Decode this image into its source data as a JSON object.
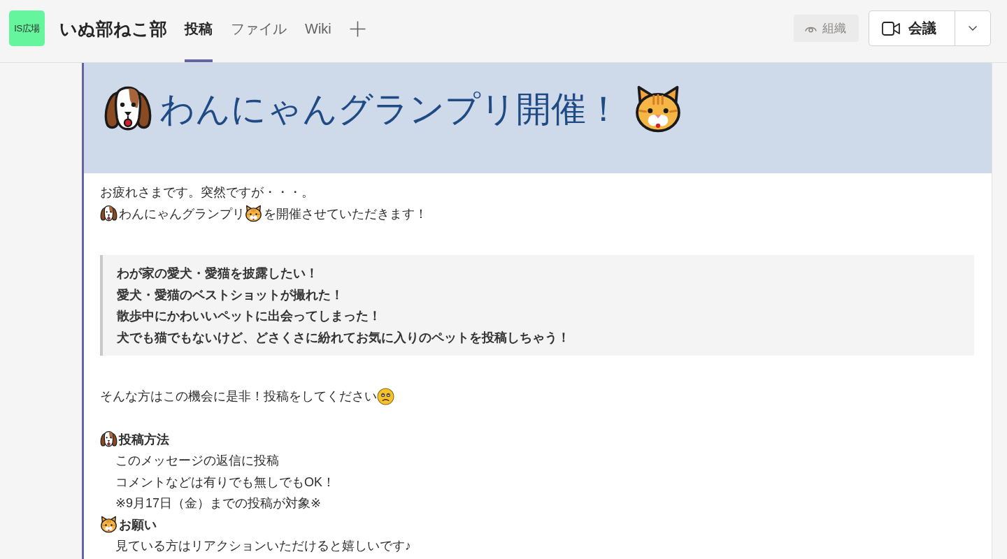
{
  "channel_header": {
    "team_avatar": {
      "label": "IS広場"
    },
    "team_name": "いぬ部ねこ部",
    "tabs": [
      {
        "label": "投稿",
        "selected": true
      },
      {
        "label": "ファイル",
        "selected": false
      },
      {
        "label": "Wiki",
        "selected": false
      }
    ],
    "org_button": {
      "label": "組織"
    },
    "meeting_button": {
      "label": "会議"
    }
  },
  "post": {
    "banner": [
      {
        "kind": "dog"
      },
      {
        "kind": "text",
        "text": "わんにゃんグランプリ開催！"
      },
      {
        "kind": "cat"
      }
    ],
    "blocks": [
      {
        "kind": "paragraph",
        "lines": [
          {
            "segments": [
              {
                "kind": "text",
                "text": "お疲れさまです。突然ですが・・・。"
              }
            ]
          },
          {
            "segments": [
              {
                "kind": "dog"
              },
              {
                "kind": "text",
                "text": "わんにゃんグランプリ"
              },
              {
                "kind": "cat"
              },
              {
                "kind": "text",
                "text": "を開催させていただきます！"
              }
            ]
          }
        ]
      },
      {
        "kind": "quote",
        "lines": [
          "わが家の愛犬・愛猫を披露したい！",
          "愛犬・愛猫のベストショットが撮れた！",
          "散歩中にかわいいペットに出会ってしまった！",
          "犬でも猫でもないけど、どさくさに紛れてお気に入りのペットを投稿しちゃう！"
        ]
      },
      {
        "kind": "paragraph",
        "lines": [
          {
            "segments": [
              {
                "kind": "text",
                "text": "そんな方はこの機会に是非！投稿をしてください"
              },
              {
                "kind": "worried"
              }
            ]
          }
        ]
      },
      {
        "kind": "section",
        "heading": [
          {
            "kind": "dog"
          },
          {
            "kind": "text",
            "text": "投稿方法"
          }
        ],
        "lines": [
          "このメッセージの返信に投稿",
          "コメントなどは有りでも無しでもOK！",
          "※9月17日（金）までの投稿が対象※"
        ]
      },
      {
        "kind": "section",
        "heading": [
          {
            "kind": "cat"
          },
          {
            "kind": "text",
            "text": "お願い"
          }
        ],
        "lines": [
          "見ている方はリアクションいただけると嬉しいです♪"
        ]
      }
    ]
  }
}
